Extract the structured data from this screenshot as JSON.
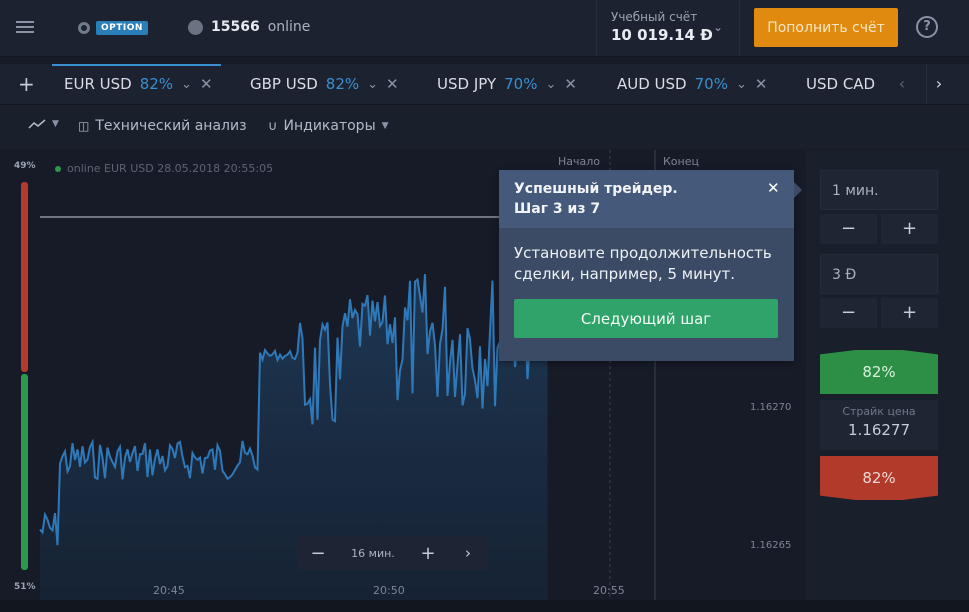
{
  "header": {
    "logo_badge": "OPTION",
    "online_count": "15566",
    "online_label": "online",
    "account_type": "Учебный счёт",
    "balance": "10 019.14 Đ",
    "deposit_label": "Пополнить счёт",
    "help_label": "?"
  },
  "tabs": [
    {
      "name": "EUR USD",
      "pct": "82%"
    },
    {
      "name": "GBP USD",
      "pct": "82%"
    },
    {
      "name": "USD JPY",
      "pct": "70%"
    },
    {
      "name": "AUD USD",
      "pct": "70%"
    },
    {
      "name": "USD CAD",
      "pct": ""
    }
  ],
  "toolbar": {
    "tech_label": "Технический анализ",
    "indicators_label": "Индикаторы"
  },
  "chart": {
    "pct_top": "49%",
    "pct_bottom": "51%",
    "info_text": "online EUR USD 28.05.2018 20:55:05",
    "start_label": "Начало",
    "end_label": "Конец",
    "price_high": "1.16270",
    "price_low": "1.16265",
    "time_labels": [
      "20:45",
      "20:50",
      "20:55"
    ],
    "zoom_value": "16 мин.",
    "colors": {
      "line": "#2f79b9",
      "up": "#2d8f45",
      "down": "#b23a2b"
    }
  },
  "panel": {
    "duration": "1 мин.",
    "amount": "3 Đ",
    "up_pct": "82%",
    "strike_label": "Страйк цена",
    "strike_value": "1.16277",
    "down_pct": "82%"
  },
  "tooltip": {
    "title1": "Успешный трейдер.",
    "title2": "Шаг 3 из 7",
    "body": "Установите продолжительность сделки, например, 5 минут.",
    "next_label": "Следующий шаг"
  }
}
